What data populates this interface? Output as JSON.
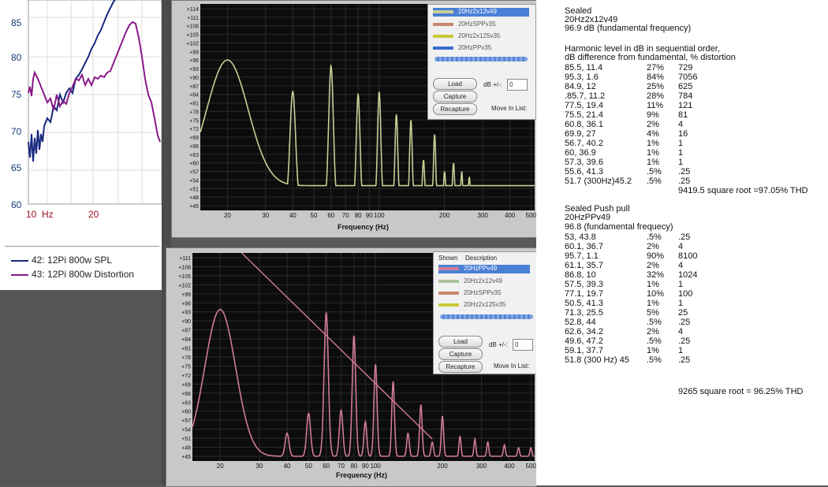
{
  "left_chart": {
    "y_ticks": [
      "85",
      "80",
      "75",
      "70",
      "65",
      "60"
    ],
    "x_ticks": [
      "10",
      "Hz",
      "20"
    ],
    "legend": [
      {
        "label": "42: 12Pi 800w SPL",
        "color": "#1a2a80"
      },
      {
        "label": "43: 12Pi 800w Distortion",
        "color": "#8a1a8a"
      }
    ]
  },
  "top_graph": {
    "y_ticks": [
      "+114",
      "+111",
      "+108",
      "+105",
      "+102",
      "+99",
      "+96",
      "+93",
      "+90",
      "+87",
      "+84",
      "+81",
      "+78",
      "+75",
      "+72",
      "+69",
      "+66",
      "+63",
      "+60",
      "+57",
      "+54",
      "+51",
      "+48",
      "+45"
    ],
    "x_ticks": [
      "20",
      "30",
      "40",
      "50",
      "60",
      "70",
      "80",
      "90",
      "100",
      "200",
      "300",
      "400",
      "500"
    ],
    "x_label": "Frequency (Hz)",
    "panel": {
      "items": [
        {
          "label": "20Hz2x12v49",
          "color": "#c8cf94",
          "selected": true
        },
        {
          "label": "20HzSPPv35",
          "color": "#c9876f",
          "selected": false
        },
        {
          "label": "20Hz2x125v35",
          "color": "#c9c93a",
          "selected": false
        },
        {
          "label": "20HzPPv35",
          "color": "#3a6fd0",
          "selected": false
        }
      ],
      "load": "Load",
      "capture": "Capture",
      "recapture": "Recapture",
      "db_label": "dB +/-:",
      "db_value": "0",
      "move_label": "Move In List:"
    }
  },
  "bottom_graph": {
    "y_ticks": [
      "+111",
      "+108",
      "+105",
      "+102",
      "+99",
      "+96",
      "+93",
      "+90",
      "+87",
      "+84",
      "+81",
      "+78",
      "+75",
      "+72",
      "+69",
      "+66",
      "+63",
      "+60",
      "+57",
      "+54",
      "+51",
      "+48",
      "+45"
    ],
    "x_ticks": [
      "20",
      "30",
      "40",
      "50",
      "60",
      "70",
      "80",
      "90",
      "100",
      "200",
      "300",
      "400",
      "500"
    ],
    "x_label": "Frequency (Hz)",
    "panel": {
      "header_shown": "Shown",
      "header_desc": "Description",
      "items": [
        {
          "label": "20HzPPv49",
          "color": "#d07a9a",
          "selected": true
        },
        {
          "label": "20Hz2x12v49",
          "color": "#a8c29a",
          "selected": false
        },
        {
          "label": "20HzSPPv35",
          "color": "#c9876f",
          "selected": false
        },
        {
          "label": "20Hz2x125v35",
          "color": "#c9c93a",
          "selected": false
        }
      ],
      "load": "Load",
      "capture": "Capture",
      "recapture": "Recapture",
      "db_label": "dB +/-:",
      "db_value": "0",
      "move_label": "Move In List:"
    }
  },
  "notes": {
    "s1_title": "Sealed",
    "s1_name": "20Hz2x12v49",
    "s1_fund": "96.9 dB (fundamental frequency)",
    "intro1": "Harmonic level  in dB in sequential order,",
    "intro2": "dB difference from fundamental, % distortion",
    "s1_rows": [
      [
        "85.5,  11.4",
        "27%",
        "729"
      ],
      [
        "95.3,  1.6",
        "84%",
        "7056"
      ],
      [
        "84.9,  12",
        "25%",
        "625"
      ],
      [
        ".85.7, 11.2",
        "28%",
        "784"
      ],
      [
        "77.5,  19.4",
        "11%",
        "121"
      ],
      [
        "75.5,  21.4",
        "9%",
        "81"
      ],
      [
        "60.8,  36.1",
        "2%",
        "4"
      ],
      [
        "69.9,  27",
        "4%",
        "16"
      ],
      [
        "56.7,  40.2",
        "1%",
        "1"
      ],
      [
        "60,     36.9",
        "1%",
        "1"
      ],
      [
        "57.3,  39.6",
        "1%",
        "1"
      ],
      [
        "55.6,  41.3",
        ".5%",
        ".25"
      ],
      [
        "51.7  (300Hz)45.2",
        ".5%",
        ".25"
      ]
    ],
    "s1_total": "9419.5 square root =97.05% THD",
    "s2_title": "Sealed Push pull",
    "s2_name": "20HzPPv49",
    "s2_fund": "96.8 (fundamental frequecy)",
    "s2_rows": [
      [
        "53,     43.8",
        ".5%",
        ".25"
      ],
      [
        "60.1,  36.7",
        "2%",
        "4"
      ],
      [
        "95.7,  1.1",
        "90%",
        "8100"
      ],
      [
        "61.1,  35.7",
        "2%",
        "4"
      ],
      [
        "86.8,  10",
        "32%",
        "1024"
      ],
      [
        "57.5,  39.3",
        "1%",
        "1"
      ],
      [
        "77.1,  19.7",
        "10%",
        "100"
      ],
      [
        "50.5,  41.3",
        "1%",
        "1"
      ],
      [
        "71.3,  25.5",
        "5%",
        "25"
      ],
      [
        "52.8,  44",
        ".5%",
        ".25"
      ],
      [
        "62.6,  34.2",
        "2%",
        "4"
      ],
      [
        "49.6,  47.2",
        ".5%",
        ".25"
      ],
      [
        "59.1,  37.7",
        "1%",
        "1"
      ],
      [
        "51.8  (300 Hz) 45",
        ".5%",
        ".25"
      ]
    ],
    "s2_total": "9265  square root = 96.25% THD"
  }
}
